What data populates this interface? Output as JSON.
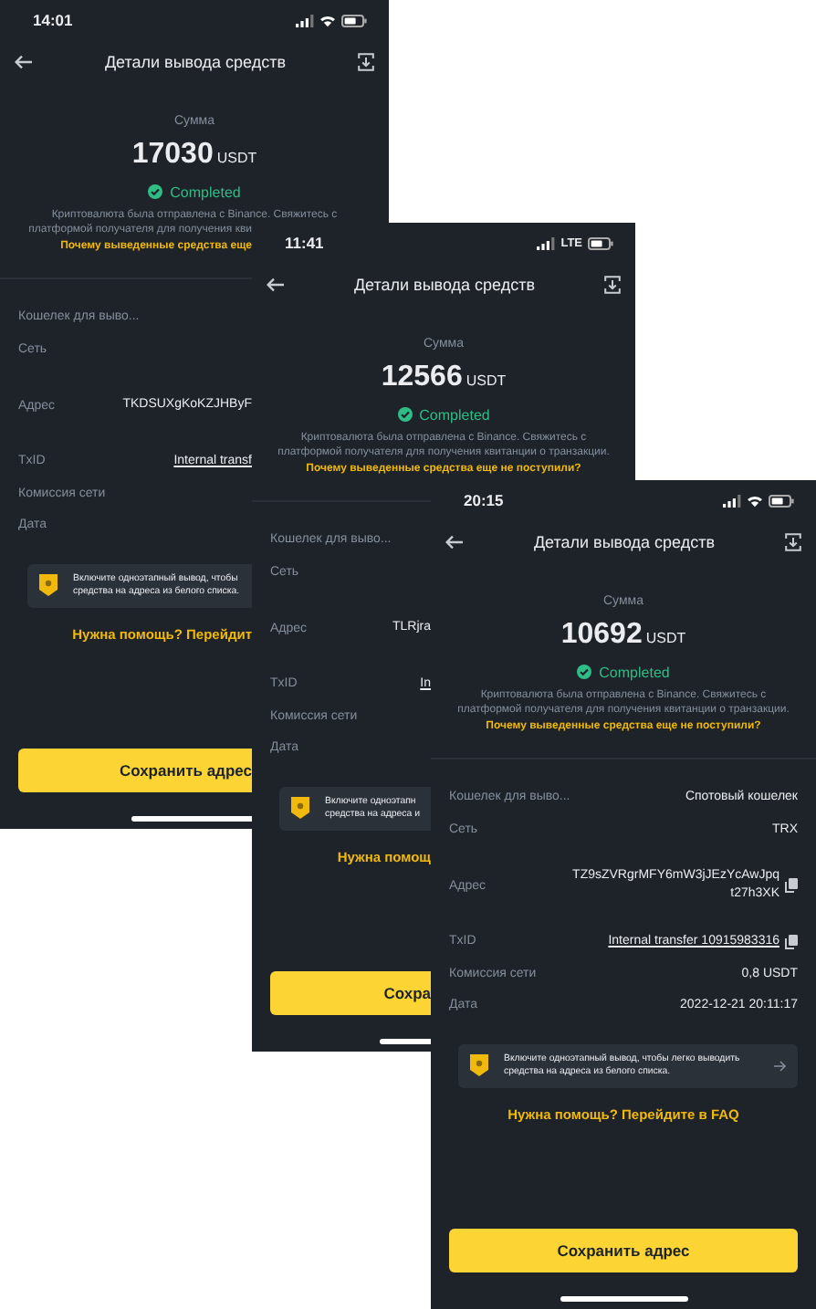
{
  "screens": [
    {
      "status": {
        "time": "14:01",
        "network": {
          "kind": "wifi"
        }
      },
      "title": "Детали вывода средств",
      "amount_label": "Сумма",
      "amount": "17030",
      "currency": "USDT",
      "state": "Completed",
      "description": [
        "Криптовалюта была отправлена с Binance. Свяжитесь с",
        "платформой получателя для получения кви"
      ],
      "help_link": "Почему выведенные средства еще",
      "rows": [
        {
          "kind": "text",
          "label": "Кошелек для выво..."
        },
        {
          "kind": "text",
          "label": "Сеть"
        },
        {
          "kind": "address",
          "label": "Адрес",
          "value": "TKDSUXgKoKZJHByF",
          "copy": false
        },
        {
          "kind": "link",
          "label": "TxID",
          "value": "Internal transf",
          "copy": false
        },
        {
          "kind": "text",
          "label": "Комиссия сети"
        },
        {
          "kind": "text",
          "label": "Дата"
        }
      ],
      "banner": {
        "lines": [
          "Включите одноэтапный вывод, чтобы",
          "средства на адреса из белого списка."
        ],
        "arrow": false
      },
      "faq": "Нужна помощь? Перейдит",
      "button": "Сохранить адрес"
    },
    {
      "status": {
        "time": "11:41",
        "network": {
          "kind": "cellular",
          "label": "LTE"
        }
      },
      "title": "Детали вывода средств",
      "amount_label": "Сумма",
      "amount": "12566",
      "currency": "USDT",
      "state": "Completed",
      "description": [
        "Криптовалюта была отправлена с Binance. Свяжитесь с",
        "платформой получателя для получения квитанции о транзакции."
      ],
      "help_link": "Почему выведенные средства еще не поступили?",
      "rows": [
        {
          "kind": "text",
          "label": "Кошелек для выво..."
        },
        {
          "kind": "text",
          "label": "Сеть"
        },
        {
          "kind": "address",
          "label": "Адрес",
          "value": "TLRjra",
          "copy": false
        },
        {
          "kind": "link",
          "label": "TxID",
          "value": "In",
          "copy": false
        },
        {
          "kind": "text",
          "label": "Комиссия сети"
        },
        {
          "kind": "text",
          "label": "Дата"
        }
      ],
      "banner": {
        "lines": [
          "Включите одноэтапн",
          "средства на адреса и"
        ],
        "arrow": false
      },
      "faq": "Нужна помощ",
      "button": "Сохра"
    },
    {
      "status": {
        "time": "20:15",
        "network": {
          "kind": "wifi"
        }
      },
      "title": "Детали вывода средств",
      "amount_label": "Сумма",
      "amount": "10692",
      "currency": "USDT",
      "state": "Completed",
      "description": [
        "Криптовалюта была отправлена с Binance. Свяжитесь с",
        "платформой получателя для получения квитанции о транзакции."
      ],
      "help_link": "Почему выведенные средства еще не поступили?",
      "rows": [
        {
          "kind": "text",
          "label": "Кошелек для выво...",
          "value": "Спотовый кошелек",
          "copy": false
        },
        {
          "kind": "text",
          "label": "Сеть",
          "value": "TRX",
          "copy": false
        },
        {
          "kind": "address",
          "label": "Адрес",
          "value": "TZ9sZVRgrMFY6mW3jJEzYcAwJpqt27h3XK",
          "copy": true
        },
        {
          "kind": "link",
          "label": "TxID",
          "value": "Internal transfer 10915983316",
          "copy": true
        },
        {
          "kind": "text",
          "label": "Комиссия сети",
          "value": "0,8 USDT",
          "copy": false
        },
        {
          "kind": "text",
          "label": "Дата",
          "value": "2022-12-21 20:11:17",
          "copy": false
        }
      ],
      "banner": {
        "lines": [
          "Включите одноэтапный вывод, чтобы легко выводить",
          "средства на адреса из белого списка."
        ],
        "arrow": true
      },
      "faq": "Нужна помощь? Перейдите в FAQ",
      "button": "Сохранить адрес"
    }
  ]
}
